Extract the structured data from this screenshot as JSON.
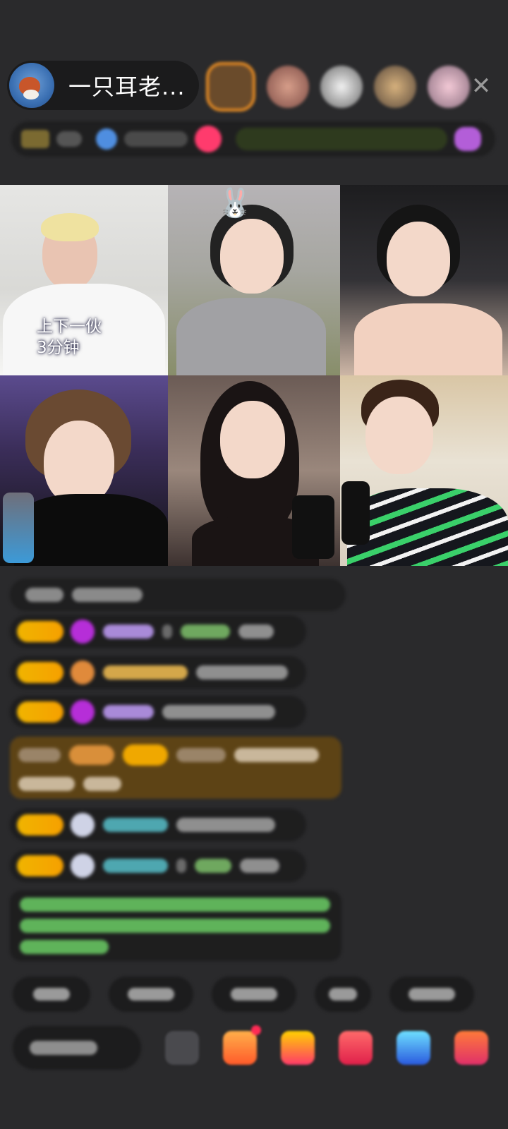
{
  "host": {
    "name": "一只耳老..."
  },
  "audience": {
    "avatars": [
      "viewer-1",
      "viewer-2",
      "viewer-3",
      "viewer-4",
      "viewer-5"
    ]
  },
  "video_grid": {
    "tile1_caption": "上下一伙\n3分钟"
  },
  "icons": {
    "close": "close-icon",
    "bunny": "🐰"
  },
  "colors": {
    "background": "#2a2a2c",
    "level_badge": "#f0b400",
    "gift_purple": "#b62ed8",
    "chat_green": "#6fd46f",
    "accent_orange": "#e98d24"
  }
}
